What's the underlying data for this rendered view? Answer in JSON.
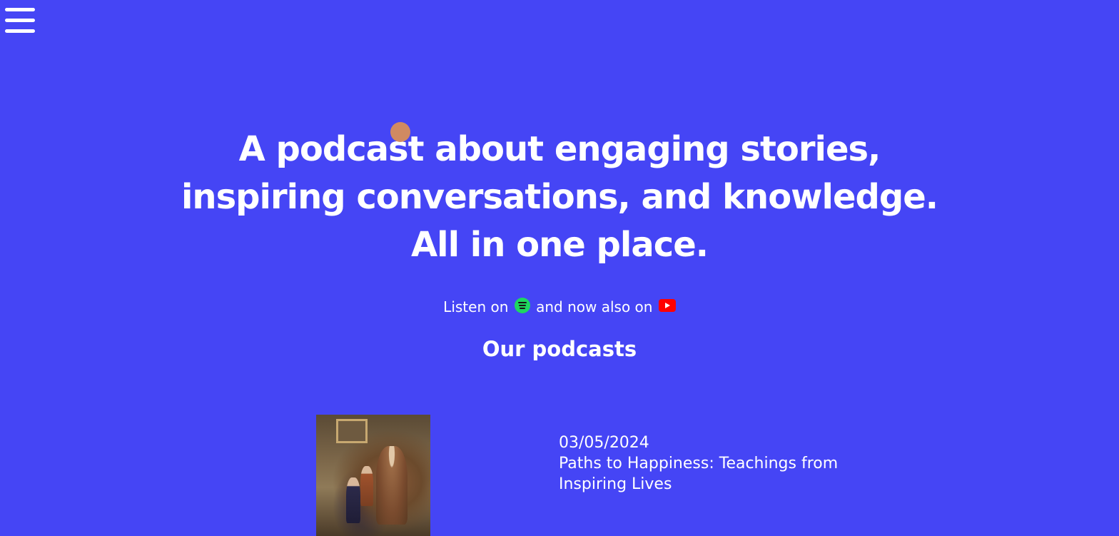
{
  "nav": {
    "menu_icon": "hamburger-menu-icon"
  },
  "hero": {
    "title_line1": "A podcast about engaging stories,",
    "title_line2": "inspiring conversations, and knowledge.",
    "title_line3": "All in one place."
  },
  "listen": {
    "prefix": "Listen on",
    "middle": "and now also on",
    "spotify_icon": "spotify-icon",
    "youtube_icon": "youtube-icon",
    "colors": {
      "spotify": "#1ed760",
      "youtube": "#ff0000"
    }
  },
  "podcasts": {
    "section_title": "Our podcasts",
    "items": [
      {
        "date": "03/05/2024",
        "title": "Paths to Happiness: Teachings from Inspiring Lives"
      }
    ]
  },
  "theme": {
    "background": "#4545f5",
    "text": "#ffffff"
  }
}
